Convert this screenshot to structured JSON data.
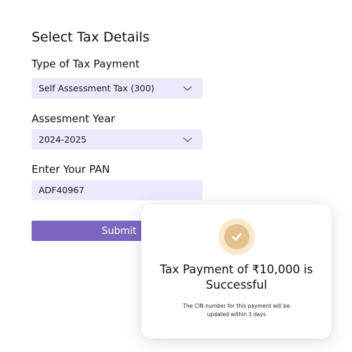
{
  "form": {
    "heading": "Select Tax Details",
    "tax_type": {
      "label": "Type of Tax Payment",
      "value": "Self Assessment Tax (300)",
      "icon": "chevron-down-icon"
    },
    "assessment_year": {
      "label": "Assesment Year",
      "value": "2024-2025",
      "icon": "chevron-down-icon"
    },
    "pan": {
      "label": "Enter Your PAN",
      "value": "ADF40967"
    },
    "submit_label": "Submit"
  },
  "success_card": {
    "icon": "check-circle-icon",
    "title": "Tax Payment of ₹10,000 is Successful",
    "note": "The CIN number for this payment will be updated within 3 days"
  },
  "colors": {
    "field_bg": "#ebe9fb",
    "button": "#7c66bf",
    "check_outer": "#fbe9cf",
    "check_inner": "#e3c08f"
  }
}
